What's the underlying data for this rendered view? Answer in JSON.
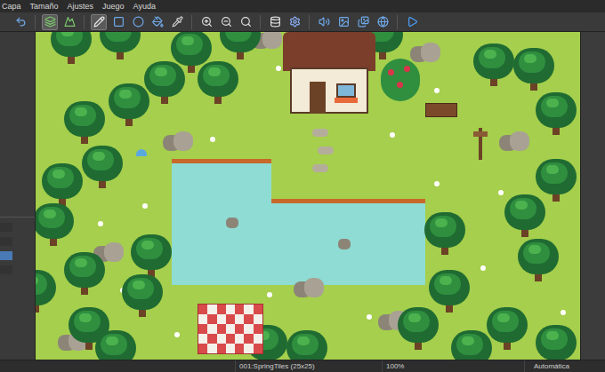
{
  "window": {
    "title": ""
  },
  "menu": [
    {
      "label": "Capa"
    },
    {
      "label": "Tamaño"
    },
    {
      "label": "Ajustes"
    },
    {
      "label": "Juego"
    },
    {
      "label": "Ayuda"
    }
  ],
  "toolbar": [
    {
      "kind": "undo",
      "selected": false
    },
    {
      "kind": "separator",
      "selected": false
    },
    {
      "kind": "layer-lower",
      "selected": true
    },
    {
      "kind": "layer-upper",
      "selected": false
    },
    {
      "kind": "separator",
      "selected": false
    },
    {
      "kind": "pencil",
      "selected": true
    },
    {
      "kind": "rectangle",
      "selected": false
    },
    {
      "kind": "circle",
      "selected": false
    },
    {
      "kind": "fill",
      "selected": false
    },
    {
      "kind": "picker",
      "selected": false
    },
    {
      "kind": "separator",
      "selected": false
    },
    {
      "kind": "zoom-in",
      "selected": false
    },
    {
      "kind": "zoom-out",
      "selected": false
    },
    {
      "kind": "zoom-fit",
      "selected": false
    },
    {
      "kind": "separator",
      "selected": false
    },
    {
      "kind": "database",
      "selected": false
    },
    {
      "kind": "settings",
      "selected": false
    },
    {
      "kind": "separator",
      "selected": false
    },
    {
      "kind": "sound",
      "selected": false
    },
    {
      "kind": "image",
      "selected": false
    },
    {
      "kind": "images",
      "selected": false
    },
    {
      "kind": "world",
      "selected": false
    },
    {
      "kind": "separator",
      "selected": false
    },
    {
      "kind": "play",
      "selected": false
    }
  ],
  "map_tree": [
    {
      "selected": false
    },
    {
      "selected": false
    },
    {
      "selected": true
    },
    {
      "selected": false
    }
  ],
  "status_bar": {
    "map": "001:SpringTiles (25x25)",
    "zoom": "100%",
    "mode": "Automática"
  }
}
